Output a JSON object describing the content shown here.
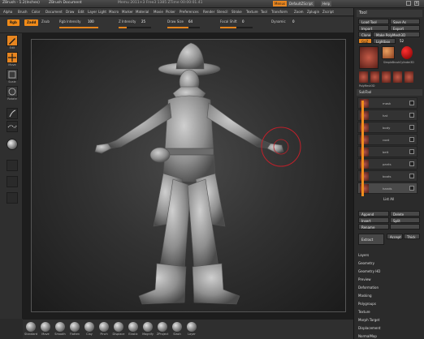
{
  "title_bar": {
    "app_title": "ZBrush - 1.2(Inches)",
    "document_title": "ZBrush Document",
    "memory_info": "Memu 2011+3  Free3 1385  ZTime 00:00:01.41",
    "menus_button": "Menus",
    "script_button": "DefaultZScript",
    "help_button": "Help"
  },
  "menu_bar": {
    "items": [
      "Alpha",
      "Brush",
      "Color",
      "Document",
      "Draw",
      "Edit",
      "Layer",
      "Light",
      "Macro",
      "Marker",
      "Material",
      "Movie",
      "Picker",
      "Preferences",
      "Render",
      "Stencil",
      "Stroke",
      "Texture",
      "Tool",
      "Transform",
      "Zoom",
      "Zplugin",
      "Zscript"
    ]
  },
  "toolbar": {
    "rgb_button": "Rgb",
    "zadd_button": "Zadd",
    "zsub_label": "Zsub",
    "rgb_intensity_label": "Rgb Intensity",
    "rgb_intensity_value": "100",
    "z_intensity_label": "Z Intensity",
    "z_intensity_value": "25",
    "draw_size_label": "Draw Size",
    "draw_size_value": "64",
    "focal_shift_label": "Focal Shift",
    "focal_shift_value": "0",
    "dynamic_label": "Dynamic",
    "dynamic_value": "0",
    "rgb_intensity_level": 1.0,
    "z_intensity_level": 0.25,
    "draw_size_level": 0.64,
    "focal_shift_level": 0.5
  },
  "left_tray": {
    "edit_label": "Edit",
    "move_label": "Move",
    "scale_label": "Scale",
    "rotate_label": "Rotate",
    "brush_icon": "brush-icon",
    "stroke_icon": "stroke-icon",
    "material_icon": "sphere-icon"
  },
  "bottom_shelf": {
    "brushes": [
      "Standard",
      "Move",
      "Smooth",
      "Flatten",
      "Clay",
      "Pinch",
      "Displace",
      "Elastic",
      "Magnify",
      "ZProject",
      "Slash",
      "Layer"
    ]
  },
  "right_tray": {
    "panel_title": "Tool",
    "load_tool": "Load Tool",
    "save_as": "Save As",
    "import": "Import",
    "export": "Export",
    "clone": "Clone",
    "make_polymesh": "Make PolyMesh3D",
    "goz": "GoZ",
    "lightbox": "Lightbox",
    "lightbox_value": "52",
    "thumb_labels": [
      "Character",
      "SimpleBrush",
      "Cylinder3D",
      "PolyMesh3D"
    ],
    "subtool_header": "SubTool",
    "subtools": [
      "mask",
      "hat",
      "body",
      "coat",
      "belt",
      "pants",
      "boots",
      "hands"
    ],
    "list_all": "List All",
    "append": "Append",
    "delete": "Delete",
    "insert": "Insert",
    "split": "Split",
    "rename": "Rename",
    "extract": "Extract",
    "accept": "Accept",
    "thick": "Thick",
    "sections": [
      "Layers",
      "Geometry",
      "Geometry HD",
      "Preview",
      "Deformation",
      "Masking",
      "Polygroups",
      "Texture",
      "Morph Target",
      "Displacement",
      "NormalMap"
    ]
  },
  "viewport": {
    "figure_icon": "character-model-icon",
    "cursor_icon": "brush-cursor-icon"
  },
  "colors": {
    "accent": "#f08a18",
    "panel_bg": "#2b2b2b",
    "cursor": "#c0202a"
  }
}
